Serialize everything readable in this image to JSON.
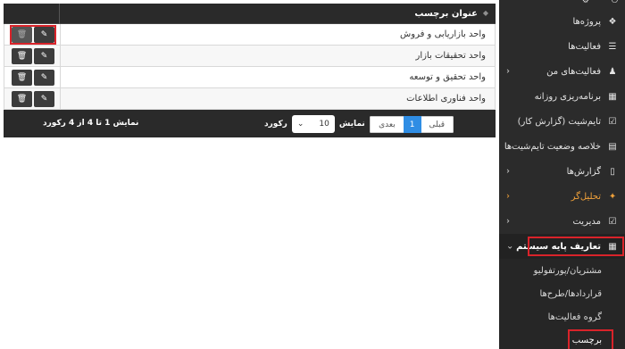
{
  "table": {
    "header_title": "عنوان برچسب",
    "rows": [
      {
        "name": "واحد بازاریابی و فروش"
      },
      {
        "name": "واحد تحقیقات بازار"
      },
      {
        "name": "واحد تحقیق و توسعه"
      },
      {
        "name": "واحد فناوری اطلاعات"
      }
    ],
    "edit_icon": "edit-icon",
    "delete_icon": "trash-icon"
  },
  "footer": {
    "pager_prev": "قبلی",
    "pager_current": "1",
    "pager_next": "بعدی",
    "length_label_before": "نمایش",
    "length_value": "10",
    "length_label_after": "رکورد",
    "info": "نمایش 1 تا 4 از 4 رکورد"
  },
  "sidebar": {
    "items": [
      {
        "label": "پروژه‌ها",
        "icon": "cubes-icon"
      },
      {
        "label": "فعالیت‌ها",
        "icon": "list-icon"
      },
      {
        "label": "فعالیت‌های من",
        "icon": "person-icon"
      },
      {
        "label": "برنامه‌ریزی روزانه",
        "icon": "table-icon"
      },
      {
        "label": "تایم‌شیت (گزارش کار)",
        "icon": "calendar-check-icon"
      },
      {
        "label": "خلاصه وضعیت تایم‌شیت‌ها",
        "icon": "list-alt-icon"
      },
      {
        "label": "گزارش‌ها",
        "icon": "file-icon"
      },
      {
        "label": "تحلیل‌گر",
        "icon": "magic-wand-icon"
      },
      {
        "label": "مدیریت",
        "icon": "check-square-icon"
      },
      {
        "label": "تعاریف پایه سیستم",
        "icon": "grid-icon"
      }
    ],
    "subitems": [
      {
        "label": "مشتریان/پورتفولیو"
      },
      {
        "label": "قراردادها/طرح‌ها"
      },
      {
        "label": "گروه فعالیت‌ها"
      },
      {
        "label": "برچسب"
      }
    ]
  },
  "colors": {
    "dark": "#2a2a2a",
    "accent_orange": "#f0a13a",
    "pager_blue": "#2f8de4",
    "highlight_red": "#d9232a"
  }
}
